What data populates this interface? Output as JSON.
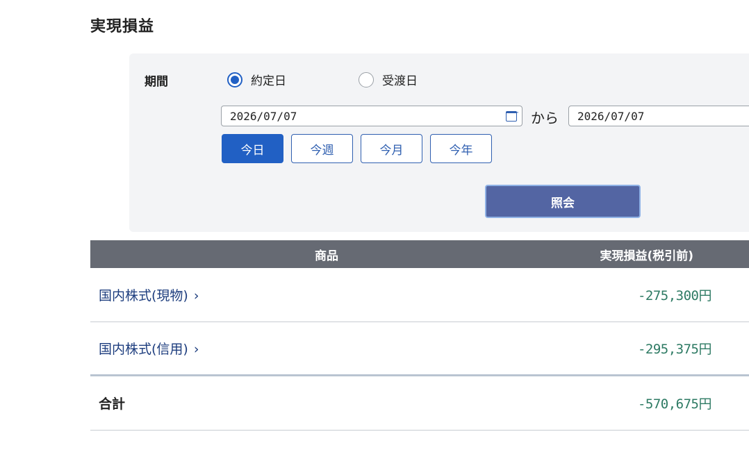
{
  "page": {
    "title": "実現損益"
  },
  "filter": {
    "period_label": "期間",
    "radio_options": [
      {
        "label": "約定日",
        "checked": true
      },
      {
        "label": "受渡日",
        "checked": false
      }
    ],
    "date_from": "2026/07/07",
    "date_to": "2026/07/07",
    "range_separator": "から",
    "quick_buttons": [
      {
        "label": "今日",
        "active": true
      },
      {
        "label": "今週",
        "active": false
      },
      {
        "label": "今月",
        "active": false
      },
      {
        "label": "今年",
        "active": false
      }
    ],
    "search_label": "照会"
  },
  "table": {
    "headers": {
      "product": "商品",
      "pl": "実現損益(税引前)"
    },
    "rows": [
      {
        "name": "国内株式(現物)",
        "chevron": "›",
        "value": "-275,300円"
      },
      {
        "name": "国内株式(信用)",
        "chevron": "›",
        "value": "-295,375円"
      }
    ],
    "total": {
      "name": "合計",
      "value": "-570,675円"
    }
  },
  "colors": {
    "accent": "#2160c4",
    "header_bg": "#666a73",
    "value_text": "#2d7a63",
    "link_text": "#1d3d7e"
  }
}
